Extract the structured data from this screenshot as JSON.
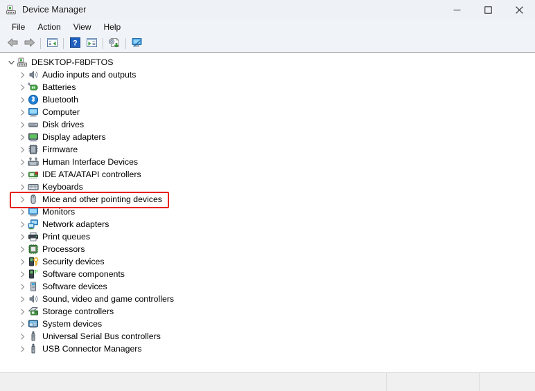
{
  "window": {
    "title": "Device Manager",
    "icon": "device-manager-icon",
    "controls": {
      "minimize": "Minimize",
      "maximize": "Maximize",
      "close": "Close"
    }
  },
  "menubar": {
    "items": [
      {
        "label": "File"
      },
      {
        "label": "Action"
      },
      {
        "label": "View"
      },
      {
        "label": "Help"
      }
    ]
  },
  "toolbar": {
    "buttons": [
      {
        "name": "back-button",
        "icon": "left-arrow-icon",
        "tooltip": "Back"
      },
      {
        "name": "forward-button",
        "icon": "right-arrow-icon",
        "tooltip": "Forward"
      },
      {
        "name": "show-hide-console-tree-button",
        "icon": "console-tree-icon",
        "tooltip": "Show/Hide Console Tree"
      },
      {
        "name": "help-button",
        "icon": "question-mark-icon",
        "tooltip": "Help"
      },
      {
        "name": "properties-button",
        "icon": "properties-panel-icon",
        "tooltip": "Properties"
      },
      {
        "name": "update-driver-button",
        "icon": "update-driver-icon",
        "tooltip": "Update Driver"
      },
      {
        "name": "scan-hardware-changes-button",
        "icon": "scan-monitor-icon",
        "tooltip": "Scan for hardware changes"
      }
    ]
  },
  "tree": {
    "root": {
      "label": "DESKTOP-F8DFTOS",
      "icon": "computer-root-icon",
      "expanded": true,
      "chevron": "chevron-down"
    },
    "items": [
      {
        "label": "Audio inputs and outputs",
        "icon": "speaker-icon",
        "chevron": "chevron-right",
        "highlighted": false
      },
      {
        "label": "Batteries",
        "icon": "battery-icon",
        "chevron": "chevron-right",
        "highlighted": false
      },
      {
        "label": "Bluetooth",
        "icon": "bluetooth-icon",
        "chevron": "chevron-right",
        "highlighted": false
      },
      {
        "label": "Computer",
        "icon": "monitor-icon",
        "chevron": "chevron-right",
        "highlighted": false
      },
      {
        "label": "Disk drives",
        "icon": "disk-drive-icon",
        "chevron": "chevron-right",
        "highlighted": false
      },
      {
        "label": "Display adapters",
        "icon": "display-adapter-icon",
        "chevron": "chevron-right",
        "highlighted": false
      },
      {
        "label": "Firmware",
        "icon": "firmware-chip-icon",
        "chevron": "chevron-right",
        "highlighted": false
      },
      {
        "label": "Human Interface Devices",
        "icon": "hid-keyboard-icon",
        "chevron": "chevron-right",
        "highlighted": false
      },
      {
        "label": "IDE ATA/ATAPI controllers",
        "icon": "ide-controller-icon",
        "chevron": "chevron-right",
        "highlighted": false
      },
      {
        "label": "Keyboards",
        "icon": "keyboard-icon",
        "chevron": "chevron-right",
        "highlighted": false
      },
      {
        "label": "Mice and other pointing devices",
        "icon": "mouse-icon",
        "chevron": "chevron-right",
        "highlighted": true
      },
      {
        "label": "Monitors",
        "icon": "monitor-icon",
        "chevron": "chevron-right",
        "highlighted": false
      },
      {
        "label": "Network adapters",
        "icon": "network-adapter-icon",
        "chevron": "chevron-right",
        "highlighted": false
      },
      {
        "label": "Print queues",
        "icon": "printer-icon",
        "chevron": "chevron-right",
        "highlighted": false
      },
      {
        "label": "Processors",
        "icon": "processor-icon",
        "chevron": "chevron-right",
        "highlighted": false
      },
      {
        "label": "Security devices",
        "icon": "security-key-icon",
        "chevron": "chevron-right",
        "highlighted": false
      },
      {
        "label": "Software components",
        "icon": "software-component-icon",
        "chevron": "chevron-right",
        "highlighted": false
      },
      {
        "label": "Software devices",
        "icon": "software-device-icon",
        "chevron": "chevron-right",
        "highlighted": false
      },
      {
        "label": "Sound, video and game controllers",
        "icon": "speaker-icon",
        "chevron": "chevron-right",
        "highlighted": false
      },
      {
        "label": "Storage controllers",
        "icon": "storage-controller-icon",
        "chevron": "chevron-right",
        "highlighted": false
      },
      {
        "label": "System devices",
        "icon": "system-device-icon",
        "chevron": "chevron-right",
        "highlighted": false
      },
      {
        "label": "Universal Serial Bus controllers",
        "icon": "usb-icon",
        "chevron": "chevron-right",
        "highlighted": false
      },
      {
        "label": "USB Connector Managers",
        "icon": "usb-icon",
        "chevron": "chevron-right",
        "highlighted": false
      }
    ]
  },
  "statusbar": {
    "panes": [
      {
        "text": ""
      },
      {
        "text": ""
      },
      {
        "text": ""
      }
    ]
  },
  "colors": {
    "highlight_border": "#e8211b",
    "titlebar_bg": "#eef2f6",
    "content_bg": "#ffffff",
    "statusbar_bg": "#f0f0f0"
  }
}
